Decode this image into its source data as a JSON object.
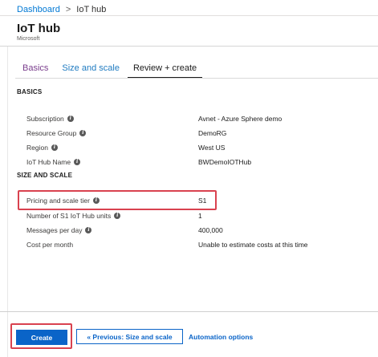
{
  "breadcrumb": {
    "root": "Dashboard",
    "separator": ">",
    "current": "IoT hub"
  },
  "header": {
    "title": "IoT hub",
    "subtitle": "Microsoft"
  },
  "tabs": [
    {
      "label": "Basics"
    },
    {
      "label": "Size and scale"
    },
    {
      "label": "Review + create"
    }
  ],
  "sections": {
    "basics": {
      "heading": "BASICS",
      "rows": [
        {
          "label": "Subscription",
          "value": "Avnet - Azure Sphere demo"
        },
        {
          "label": "Resource Group",
          "value": "DemoRG"
        },
        {
          "label": "Region",
          "value": "West US"
        },
        {
          "label": "IoT Hub Name",
          "value": "BWDemoIOTHub"
        }
      ]
    },
    "size_and_scale": {
      "heading": "SIZE AND SCALE",
      "rows": [
        {
          "label": "Pricing and scale tier",
          "value": "S1"
        },
        {
          "label": "Number of S1 IoT Hub units",
          "value": "1"
        },
        {
          "label": "Messages per day",
          "value": "400,000"
        },
        {
          "label": "Cost per month",
          "value": "Unable to estimate costs at this time"
        }
      ]
    }
  },
  "info_icon_glyph": "i",
  "footer": {
    "create_label": "Create",
    "previous_label": "« Previous: Size and scale",
    "automation_label": "Automation options"
  },
  "colors": {
    "accent": "#0a64c8",
    "highlight": "#d9424f"
  }
}
